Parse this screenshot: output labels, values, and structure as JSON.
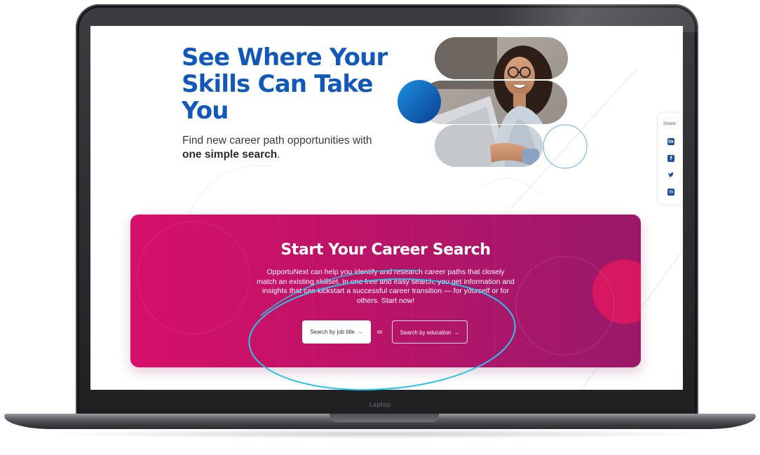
{
  "device": {
    "label": "Laptop"
  },
  "hero": {
    "title": "See Where Your Skills Can Take You",
    "subtitle_prefix": "Find new career path opportunities with ",
    "subtitle_emphasis": "one simple search",
    "subtitle_suffix": "."
  },
  "share": {
    "label": "Share:",
    "items": [
      {
        "icon": "linkedin-icon",
        "glyph": "in"
      },
      {
        "icon": "facebook-icon",
        "glyph": "f"
      },
      {
        "icon": "twitter-icon",
        "glyph": "t"
      },
      {
        "icon": "email-icon",
        "glyph": "✉"
      }
    ]
  },
  "career_card": {
    "title": "Start Your Career Search",
    "description": "OpportuNext can help you identify and research career paths that closely match an existing skillset. In one free and easy search, you get information and insights that can kickstart a successful career transition — for yourself or for others. Start now!",
    "job_button": "Search by job title",
    "separator": "or",
    "education_button": "Search by education",
    "arrow": "→"
  },
  "colors": {
    "brand_blue": "#1258b8",
    "card_pink": "#d6106a",
    "card_purple": "#9a1868",
    "annotation": "#29c4e6"
  }
}
